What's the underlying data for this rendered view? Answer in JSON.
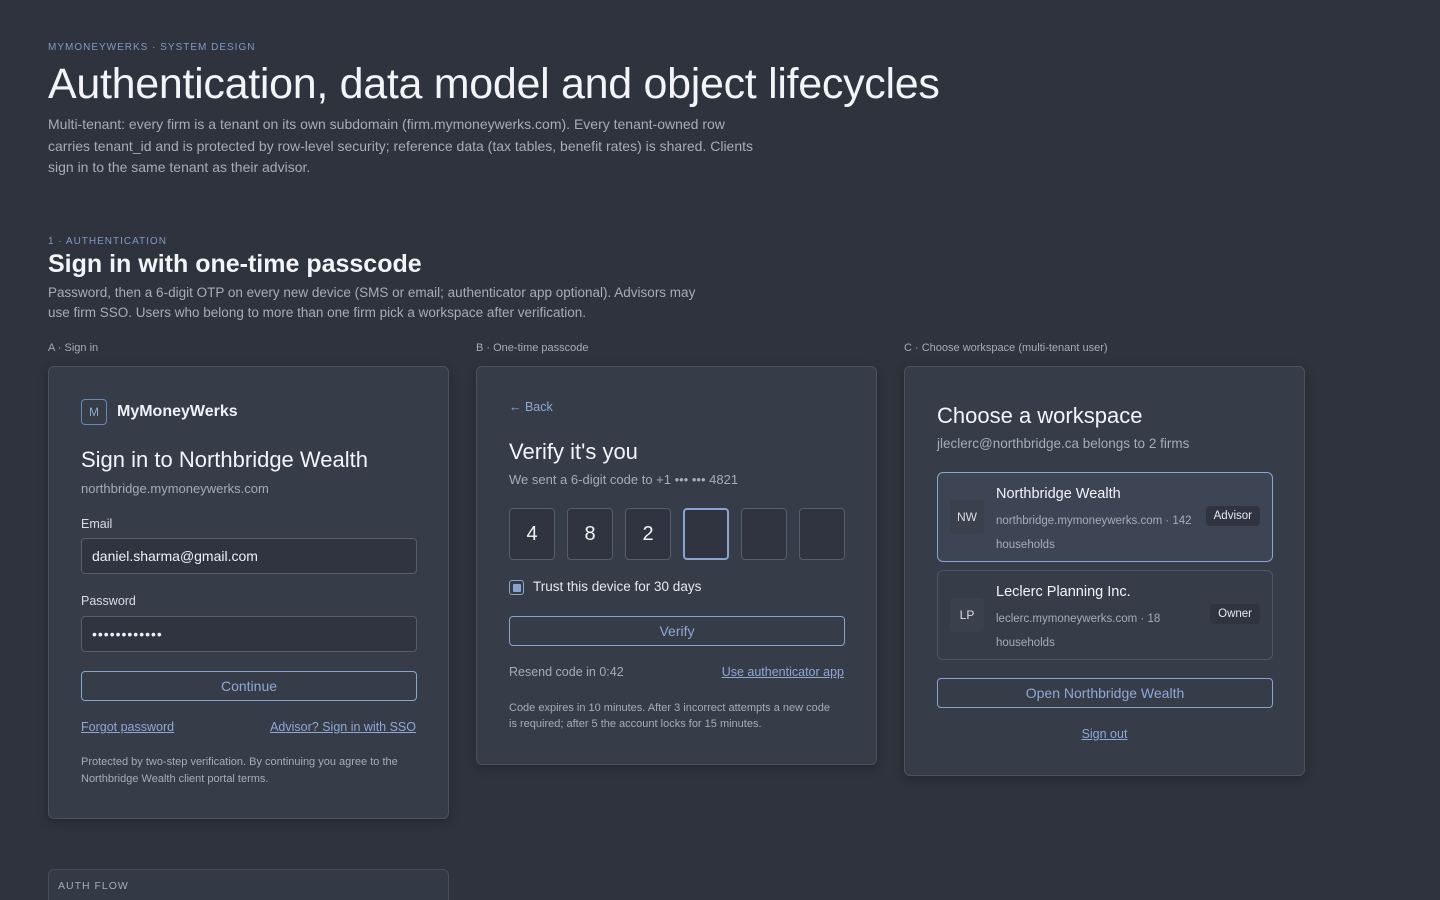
{
  "header": {
    "eyebrow": "MYMONEYWERKS · SYSTEM DESIGN",
    "title": "Authentication, data model and object lifecycles",
    "description": "Multi-tenant: every firm is a tenant on its own subdomain (firm.mymoneywerks.com). Every tenant-owned row carries tenant_id and is protected by row-level security; reference data (tax tables, benefit rates) is shared. Clients sign in to the same tenant as their advisor."
  },
  "section": {
    "eyebrow": "1 · AUTHENTICATION",
    "title": "Sign in with one-time passcode",
    "description": "Password, then a 6-digit OTP on every new device (SMS or email; authenticator app optional). Advisors may use firm SSO. Users who belong to more than one firm pick a workspace after verification."
  },
  "panel_a": {
    "caption": "A · Sign in",
    "brand_mark": "M",
    "brand_name": "MyMoneyWerks",
    "title": "Sign in to Northbridge Wealth",
    "subdomain": "northbridge.mymoneywerks.com",
    "email_label": "Email",
    "email_value": "daniel.sharma@gmail.com",
    "password_label": "Password",
    "password_value": "••••••••••••",
    "continue_label": "Continue",
    "forgot_label": "Forgot password",
    "sso_label": "Advisor? Sign in with SSO",
    "footer_note": "Protected by two-step verification. By continuing you agree to the Northbridge Wealth client portal terms."
  },
  "panel_b": {
    "caption": "B · One-time passcode",
    "back_label": "← Back",
    "title": "Verify it's you",
    "subtitle": "We sent a 6-digit code to +1 ••• ••• 4821",
    "otp_digits": [
      "4",
      "8",
      "2",
      "",
      "",
      ""
    ],
    "trust_label": "Trust this device for 30 days",
    "trust_checked": true,
    "verify_label": "Verify",
    "resend_text": "Resend code in 0:42",
    "authenticator_label": "Use authenticator app",
    "footer_note": "Code expires in 10 minutes. After 3 incorrect attempts a new code is required; after 5 the account locks for 15 minutes."
  },
  "panel_c": {
    "caption": "C · Choose workspace (multi-tenant user)",
    "title": "Choose a workspace",
    "subtitle": "jleclerc@northbridge.ca belongs to 2 firms",
    "workspaces": [
      {
        "initials": "NW",
        "name": "Northbridge Wealth",
        "meta": "northbridge.mymoneywerks.com · 142 households",
        "role": "Advisor",
        "selected": true
      },
      {
        "initials": "LP",
        "name": "Leclerc Planning Inc.",
        "meta": "leclerc.mymoneywerks.com · 18 households",
        "role": "Owner",
        "selected": false
      }
    ],
    "open_label": "Open Northbridge Wealth",
    "signout_label": "Sign out"
  },
  "auth_flow": {
    "label": "AUTH FLOW"
  },
  "colors": {
    "background": "#2e333d",
    "card": "#363c48",
    "accent": "#8aa4d0"
  }
}
